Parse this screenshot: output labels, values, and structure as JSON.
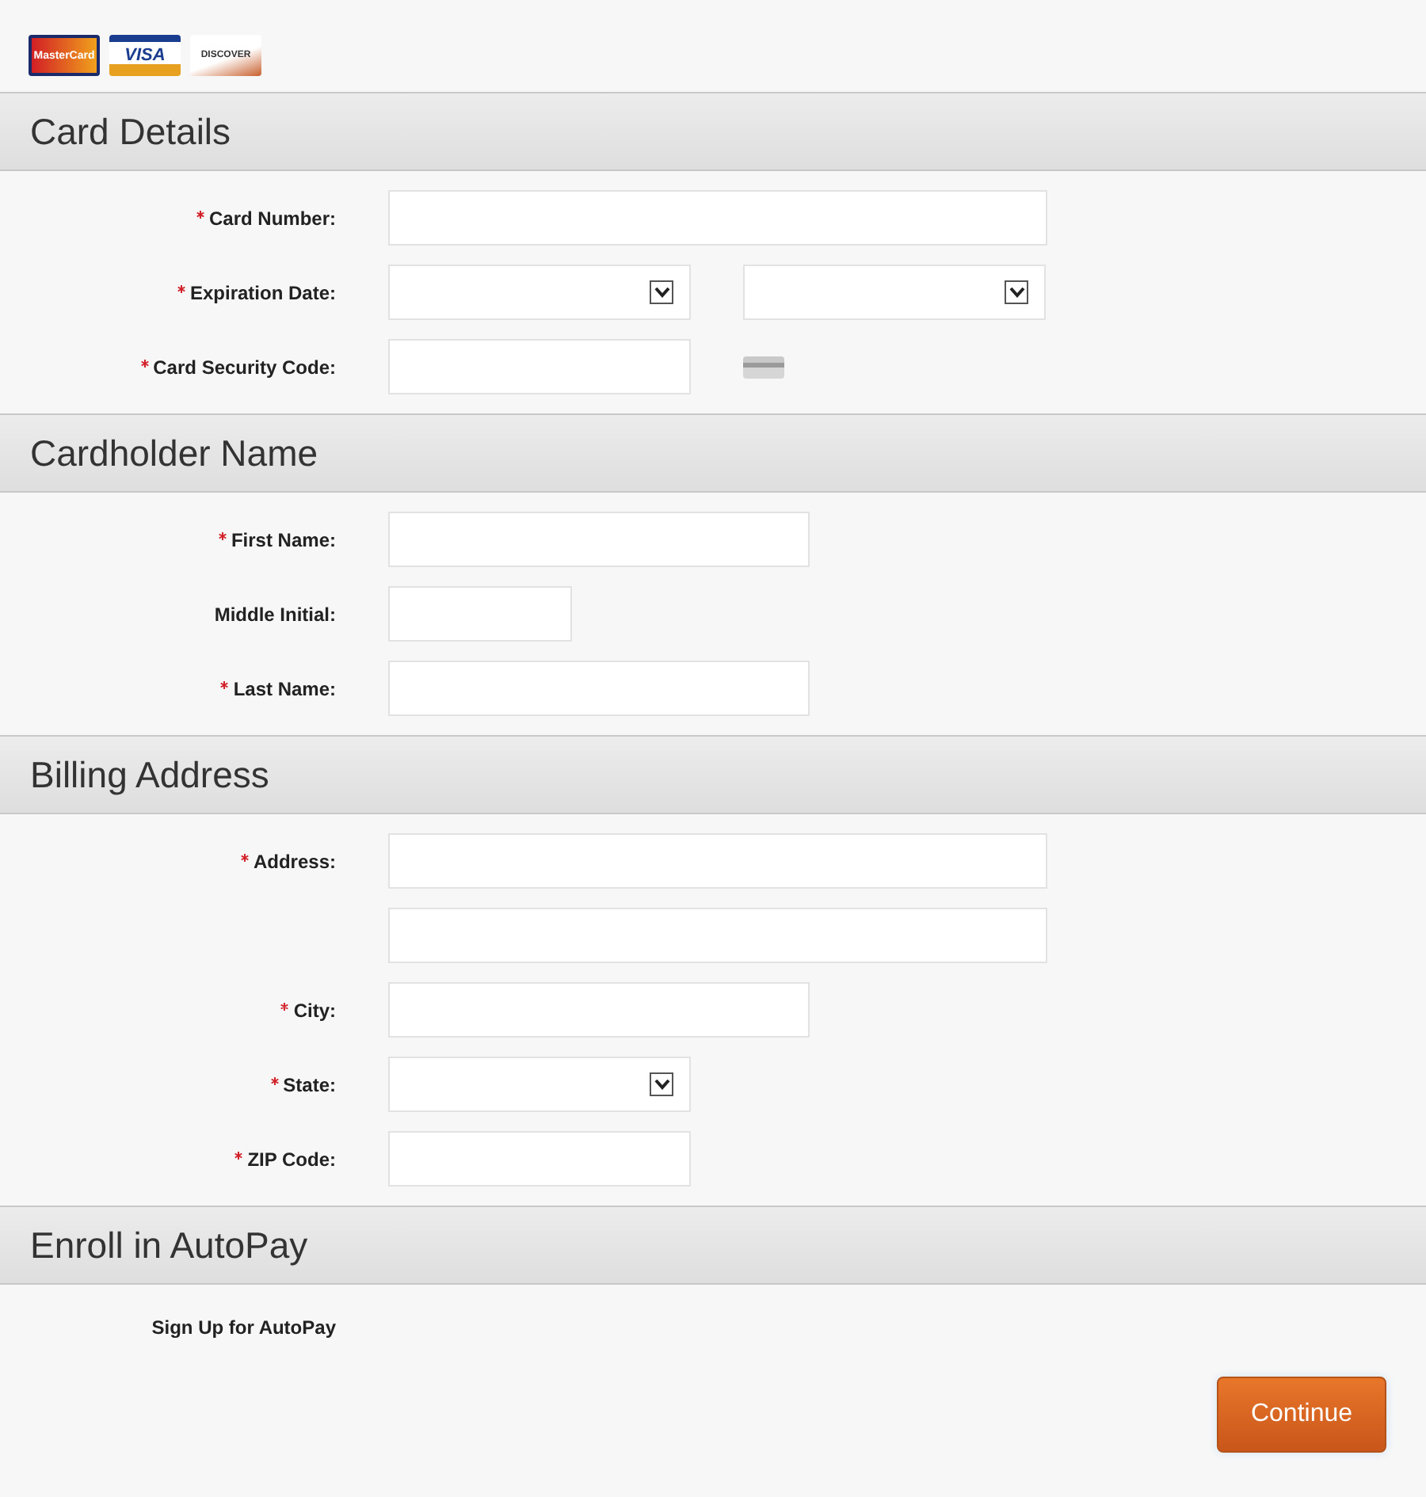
{
  "card_logos": [
    {
      "kind": "mastercard",
      "label": "MasterCard"
    },
    {
      "kind": "visa",
      "label": "VISA"
    },
    {
      "kind": "discover",
      "label": "DISCOVER"
    }
  ],
  "sections": [
    {
      "title": "Card Details",
      "rows": [
        {
          "label": "Card Number:",
          "required": true,
          "fields": [
            {
              "kind": "wide-text"
            }
          ]
        },
        {
          "label": "Expiration Date:",
          "required": true,
          "fields": [
            {
              "kind": "select"
            },
            {
              "kind": "select"
            }
          ]
        },
        {
          "label": "Card Security Code:",
          "required": true,
          "fields": [
            {
              "kind": "short-text"
            },
            {
              "kind": "card-icon"
            }
          ]
        }
      ]
    },
    {
      "title": "Cardholder Name",
      "rows": [
        {
          "label": "First Name:",
          "required": true,
          "fields": [
            {
              "kind": "medium-text"
            }
          ]
        },
        {
          "label": "Middle Initial:",
          "required": false,
          "fields": [
            {
              "kind": "tiny-text"
            }
          ]
        },
        {
          "label": "Last Name:",
          "required": true,
          "fields": [
            {
              "kind": "medium-text"
            }
          ]
        }
      ]
    },
    {
      "title": "Billing Address",
      "rows": [
        {
          "label": "Address:",
          "required": true,
          "fields": [
            {
              "kind": "wide-text"
            }
          ]
        },
        {
          "fields": [
            {
              "kind": "wide-text"
            }
          ]
        },
        {
          "label": "City:",
          "required": true,
          "fields": [
            {
              "kind": "medium-text"
            }
          ]
        },
        {
          "label": "State:",
          "required": true,
          "fields": [
            {
              "kind": "select"
            }
          ]
        },
        {
          "label": "ZIP Code:",
          "required": true,
          "fields": [
            {
              "kind": "short-text"
            }
          ]
        }
      ]
    },
    {
      "title": "Enroll in AutoPay",
      "rows": [
        {
          "label": "Sign Up for AutoPay",
          "required": false,
          "fields": []
        }
      ]
    }
  ],
  "continue_button": "Continue"
}
